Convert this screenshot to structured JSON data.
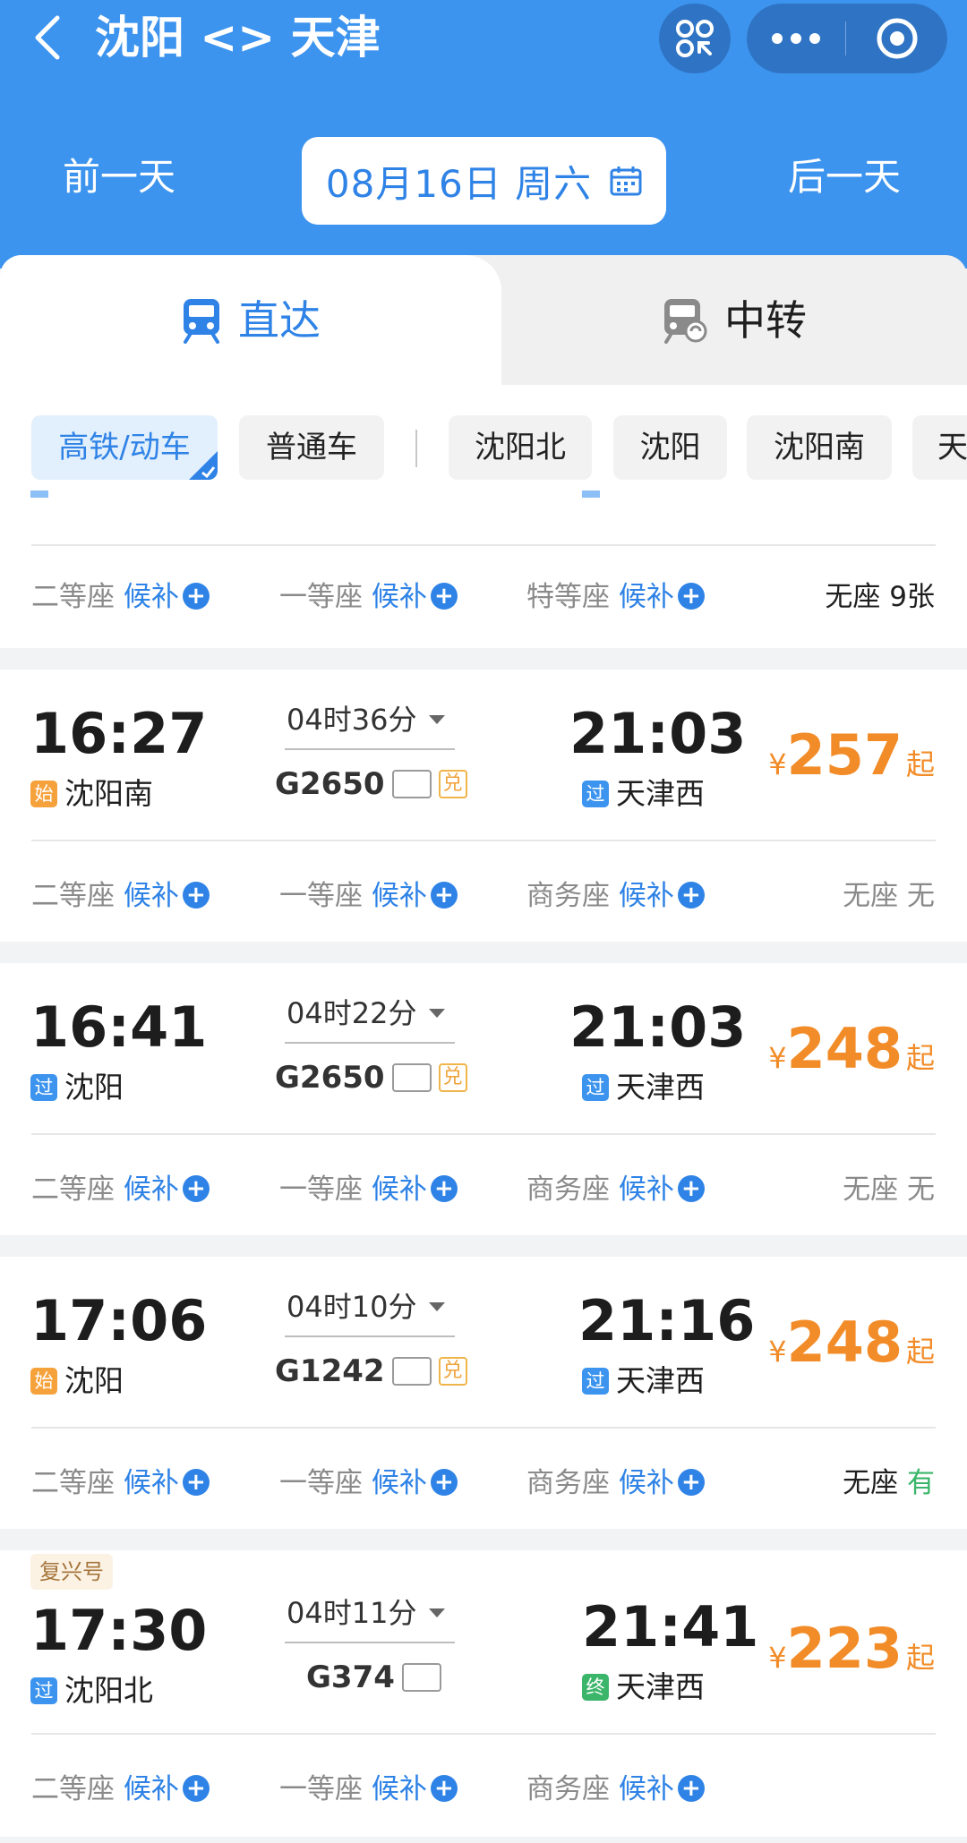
{
  "header": {
    "title": "沈阳 <> 天津",
    "prev_day": "前一天",
    "next_day": "后一天",
    "date": "08月16日 周六",
    "bg_color": "#3d94ee"
  },
  "tabs": [
    {
      "label": "直达",
      "icon": "train-icon",
      "selected": true
    },
    {
      "label": "中转",
      "icon": "transfer-train-icon",
      "selected": false
    }
  ],
  "filters": [
    {
      "label": "高铁/动车",
      "selected": true
    },
    {
      "label": "普通车",
      "selected": false
    },
    {
      "label": "沈阳北",
      "selected": false
    },
    {
      "label": "沈阳",
      "selected": false
    },
    {
      "label": "沈阳南",
      "selected": false
    },
    {
      "label": "天",
      "selected": false
    }
  ],
  "partial_row": {
    "seats": [
      {
        "name": "二等座",
        "status": "候补"
      },
      {
        "name": "一等座",
        "status": "候补"
      },
      {
        "name": "特等座",
        "status": "候补"
      }
    ],
    "no_seat": {
      "name": "无座",
      "value": "9张"
    }
  },
  "trains": [
    {
      "dep_time": "16:27",
      "dep_station": "沈阳南",
      "dep_tag": "始",
      "duration": "04时36分",
      "train_no": "G2650",
      "has_dui": true,
      "dui_label": "兑",
      "arr_time": "21:03",
      "arr_station": "天津西",
      "arr_tag": "过",
      "price_symbol": "¥",
      "price": "257",
      "price_suffix": "起",
      "seats": [
        {
          "name": "二等座",
          "status": "候补"
        },
        {
          "name": "一等座",
          "status": "候补"
        },
        {
          "name": "商务座",
          "status": "候补"
        }
      ],
      "no_seat": {
        "name": "无座",
        "value": "无"
      }
    },
    {
      "dep_time": "16:41",
      "dep_station": "沈阳",
      "dep_tag": "过",
      "duration": "04时22分",
      "train_no": "G2650",
      "has_dui": true,
      "dui_label": "兑",
      "arr_time": "21:03",
      "arr_station": "天津西",
      "arr_tag": "过",
      "price_symbol": "¥",
      "price": "248",
      "price_suffix": "起",
      "seats": [
        {
          "name": "二等座",
          "status": "候补"
        },
        {
          "name": "一等座",
          "status": "候补"
        },
        {
          "name": "商务座",
          "status": "候补"
        }
      ],
      "no_seat": {
        "name": "无座",
        "value": "无"
      }
    },
    {
      "dep_time": "17:06",
      "dep_station": "沈阳",
      "dep_tag": "始",
      "duration": "04时10分",
      "train_no": "G1242",
      "has_dui": true,
      "dui_label": "兑",
      "arr_time": "21:16",
      "arr_station": "天津西",
      "arr_tag": "过",
      "price_symbol": "¥",
      "price": "248",
      "price_suffix": "起",
      "seats": [
        {
          "name": "二等座",
          "status": "候补"
        },
        {
          "name": "一等座",
          "status": "候补"
        },
        {
          "name": "商务座",
          "status": "候补"
        }
      ],
      "no_seat": {
        "name": "无座",
        "value": "有"
      }
    },
    {
      "badge": "复兴号",
      "dep_time": "17:30",
      "dep_station": "沈阳北",
      "dep_tag": "过",
      "duration": "04时11分",
      "train_no": "G374",
      "has_dui": false,
      "arr_time": "21:41",
      "arr_station": "天津西",
      "arr_tag": "终",
      "price_symbol": "¥",
      "price": "223",
      "price_suffix": "起",
      "seats": [
        {
          "name": "二等座",
          "status": "候补"
        },
        {
          "name": "一等座",
          "status": "候补"
        },
        {
          "name": "商务座",
          "status": "候补"
        }
      ]
    }
  ],
  "colors": {
    "accent": "#2f83e6",
    "price": "#f28c28",
    "available": "#3ab569"
  }
}
